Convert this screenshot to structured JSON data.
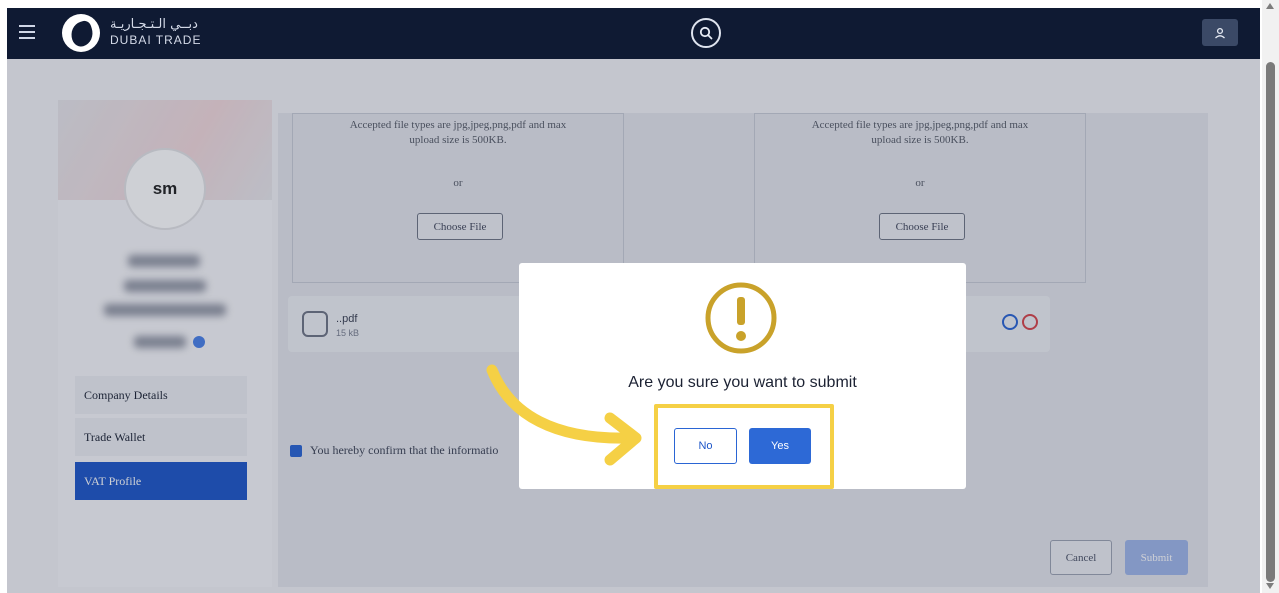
{
  "header": {
    "logo_arabic": "دبــي الـتـجـاريـة",
    "logo_english": "DUBAI TRADE",
    "menu_icon": "hamburger-icon",
    "search_icon": "search-icon",
    "user_icon": "user-icon"
  },
  "sidebar": {
    "avatar_initials": "sm",
    "items": [
      {
        "label": "Company Details"
      },
      {
        "label": "Trade Wallet"
      },
      {
        "label": "VAT Profile"
      }
    ]
  },
  "upload": {
    "hint_line1": "Accepted file types are jpg,jpeg,png,pdf and max",
    "hint_line2": "upload size is 500KB.",
    "or_text": "or",
    "choose_file_label": "Choose File"
  },
  "file": {
    "name": "..pdf",
    "size": "15 kB"
  },
  "confirm_text": "You hereby confirm that the informatio",
  "footer": {
    "cancel_label": "Cancel",
    "submit_label": "Submit"
  },
  "dialog": {
    "message": "Are you sure you want to submit",
    "no_label": "No",
    "yes_label": "Yes",
    "icon": "alert-circle-icon",
    "icon_color": "#c9a22a"
  },
  "colors": {
    "topbar": "#0f1a33",
    "primary": "#2d69d6",
    "highlight": "#f5d045",
    "sidebar_active": "#1e56c8"
  }
}
